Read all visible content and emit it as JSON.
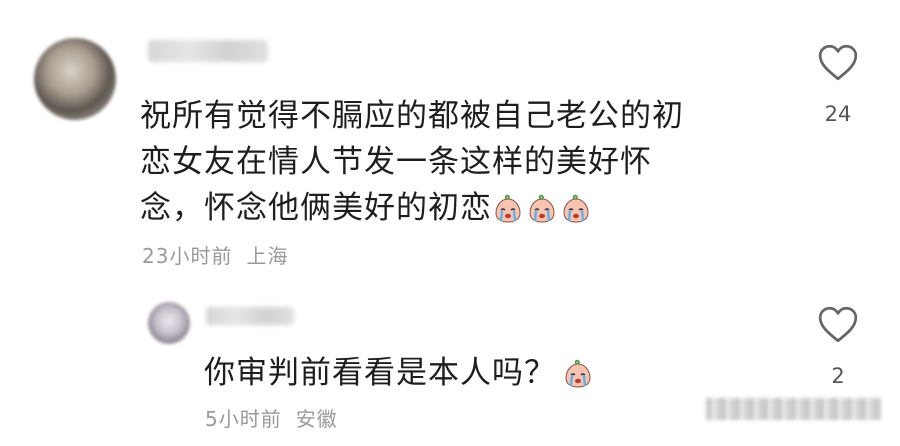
{
  "comments": [
    {
      "text_lines": [
        "祝所有觉得不膈应的都被自己老公的初",
        "恋女友在情人节发一条这样的美好怀",
        "念，怀念他俩美好的初恋"
      ],
      "emoji": "crying-face-emoji",
      "emoji_count": 3,
      "time": "23小时前",
      "location": "上海",
      "like_count": "24"
    },
    {
      "text_lines": [
        "你审判前看看是本人吗？"
      ],
      "emoji": "crying-face-emoji",
      "emoji_count": 1,
      "time": "5小时前",
      "location": "安徽",
      "like_count": "2"
    }
  ],
  "icons": {
    "like": "heart-outline-icon"
  },
  "colors": {
    "text": "#1e1e1e",
    "meta": "#9a9a9a",
    "icon": "#666666"
  }
}
